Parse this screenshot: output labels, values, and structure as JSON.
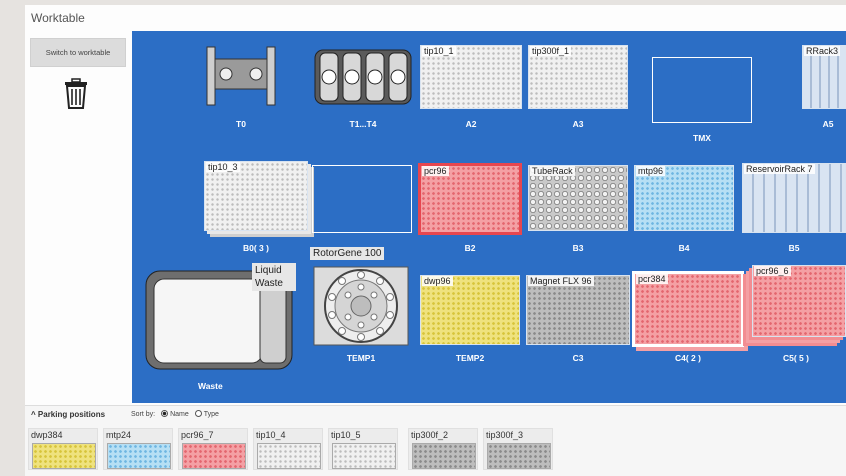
{
  "window": {
    "title": "Worktable"
  },
  "toolbar": {
    "switch_label": "Switch to worktable",
    "trash_icon": "trash-icon"
  },
  "colors": {
    "canvas": "#2c6ec5",
    "red": "#f4a0a4",
    "blue": "#b6dff4",
    "yellow": "#efe27e",
    "grey": "#f0f0f0"
  },
  "worktable": {
    "positions": {
      "T0": "T0",
      "T1T4": "T1...T4",
      "A2": "A2",
      "A3": "A3",
      "TMX": "TMX",
      "A5": "A5",
      "B0": "B0( 3 )",
      "B2": "B2",
      "B3": "B3",
      "B4": "B4",
      "B5": "B5",
      "WASTE": "Waste",
      "TEMP1": "TEMP1",
      "TEMP2": "TEMP2",
      "C3": "C3",
      "C4": "C4( 2 )",
      "C5": "C5( 5 )"
    },
    "labware": {
      "tip10_1": "tip10_1",
      "tip300f_1": "tip300f_1",
      "RRack3": "RRack3",
      "tip10_3": "tip10_3",
      "pcr96": "pcr96",
      "TubeRack": "TubeRack",
      "mtp96": "mtp96",
      "ReservoirRack7": "ReservoirRack 7",
      "RotorGene": "RotorGene 100",
      "LiquidWaste": "Liquid Waste",
      "dwp96": "dwp96",
      "MagnetFLX": "Magnet FLX 96",
      "pcr384": "pcr384",
      "pcr96_6": "pcr96_6"
    }
  },
  "parking": {
    "title": "Parking positions",
    "sort_label": "Sort by:",
    "sort_options": [
      "Name",
      "Type"
    ],
    "sort_selected": "Name",
    "items": [
      {
        "label": "dwp384",
        "color": "yellow"
      },
      {
        "label": "mtp24",
        "color": "blue"
      },
      {
        "label": "pcr96_7",
        "color": "red"
      },
      {
        "label": "tip10_4",
        "color": "grey"
      },
      {
        "label": "tip10_5",
        "color": "grey"
      },
      {
        "label": "tip300f_2",
        "color": "grey"
      },
      {
        "label": "tip300f_3",
        "color": "grey"
      }
    ]
  }
}
